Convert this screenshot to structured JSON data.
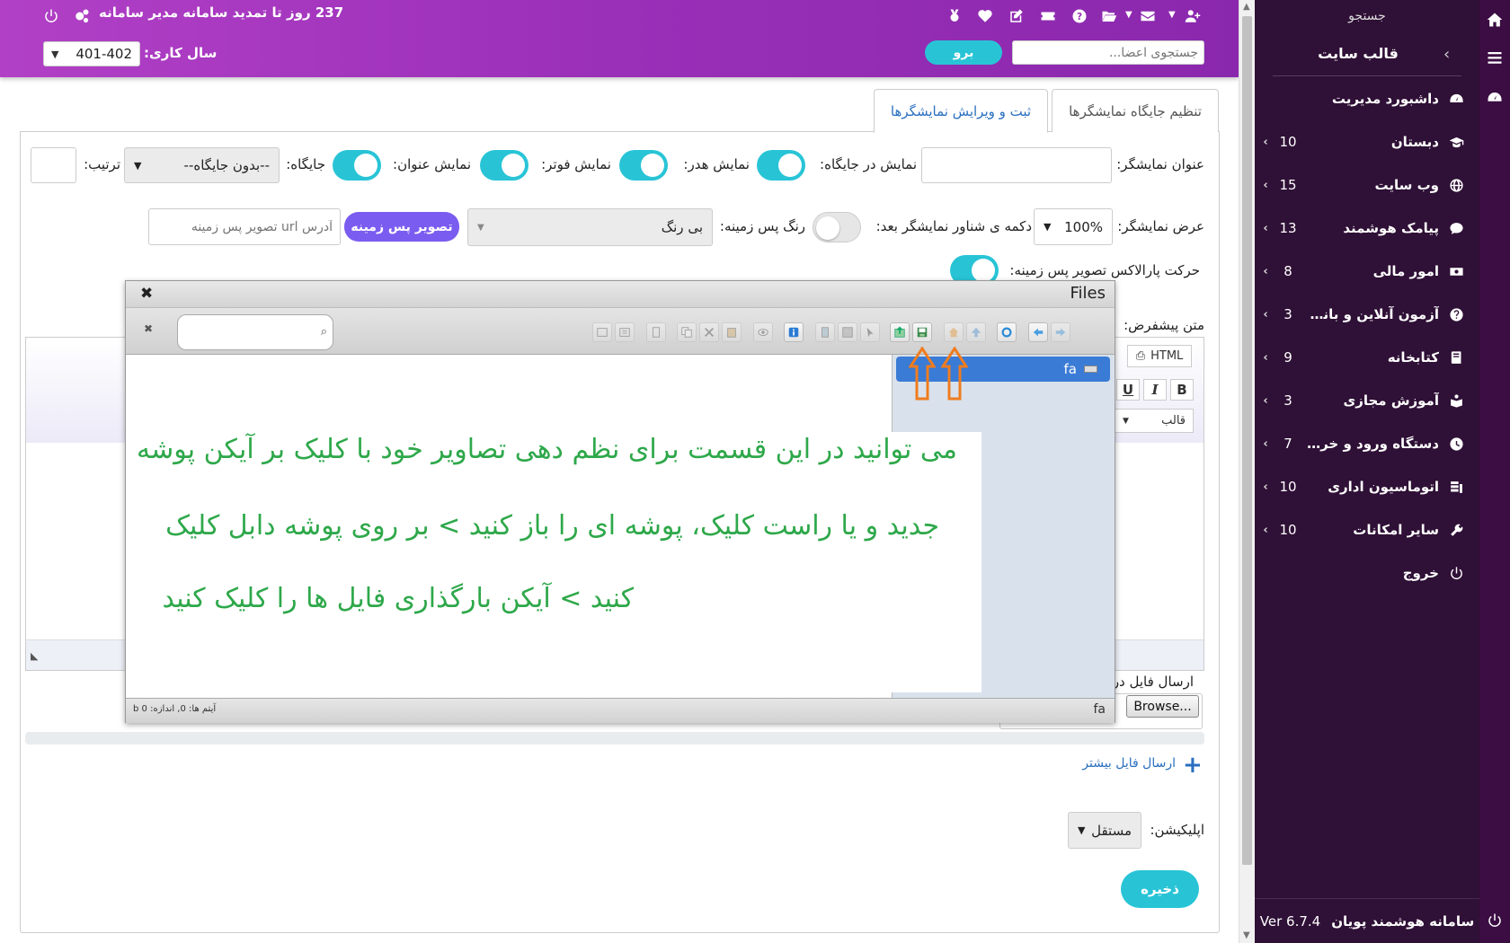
{
  "topbar": {
    "notice": "237 روز تا تمدید سامانه مدیر سامانه",
    "year_label": "سال کاری:",
    "year_value": "401-402",
    "search_placeholder": "جستجوی اعضا...",
    "go_label": "برو"
  },
  "sidebar": {
    "search_label": "جستجو",
    "section_title": "قالب سایت",
    "items": [
      {
        "label": "داشبورد مدیریت",
        "count": "",
        "icon": "dashboard-icon"
      },
      {
        "label": "دبستان",
        "count": "10",
        "icon": "graduation-cap-icon"
      },
      {
        "label": "وب سایت",
        "count": "15",
        "icon": "globe-icon"
      },
      {
        "label": "پیامک هوشمند",
        "count": "13",
        "icon": "sms-icon"
      },
      {
        "label": "امور مالی",
        "count": "8",
        "icon": "money-icon"
      },
      {
        "label": "آزمون آنلاین و بانک س...",
        "count": "3",
        "icon": "question-icon"
      },
      {
        "label": "کتابخانه",
        "count": "9",
        "icon": "book-icon"
      },
      {
        "label": "آموزش مجازی",
        "count": "3",
        "icon": "virtual-class-icon"
      },
      {
        "label": "دستگاه ورود و خروج",
        "count": "7",
        "icon": "clock-icon"
      },
      {
        "label": "اتوماسیون اداری",
        "count": "10",
        "icon": "office-icon"
      },
      {
        "label": "سایر امکانات",
        "count": "10",
        "icon": "wrench-icon"
      },
      {
        "label": "خروج",
        "count": "",
        "icon": "power-icon"
      }
    ],
    "footer_name": "سامانه هوشمند پویان",
    "footer_version": "Ver 6.7.4"
  },
  "tabs": {
    "active": "ثبت و ویرایش نمایشگرها",
    "other": "تنظیم جایگاه نمایشگرها"
  },
  "form": {
    "title_label": "عنوان نمایشگر:",
    "show_in_place": "نمایش در جایگاه:",
    "show_header": "نمایش هدر:",
    "show_footer": "نمایش فوتر:",
    "show_title": "نمایش عنوان:",
    "place_label": "جایگاه:",
    "place_value": "--بدون جایگاه--",
    "order_label": "ترتیب:",
    "width_label": "عرض نمایشگر:",
    "width_value": "100%",
    "float_btn_label": "دکمه ی شناور نمایشگر بعد:",
    "bg_color_label": "رنگ پس زمینه:",
    "bg_color_value": "بی رنگ",
    "bg_image_button": "تصویر پس زمینه",
    "bg_url_placeholder": "آدرس url تصویر پس زمینه",
    "parallax_label": "حرکت پارالاکس تصویر پس زمینه:",
    "default_text_label": "متن پیشفرض:",
    "editor_html": "HTML",
    "editor_template": "قالب",
    "upload_label": "ارسال فایل در",
    "browse_label": "Browse...",
    "more_files": "ارسال فایل بیشتر",
    "app_label": "اپلیکیشن:",
    "app_value": "مستقل",
    "save_label": "ذخیره"
  },
  "dialog": {
    "title": "Files",
    "folder": "fa",
    "status": "آیتم ها: 0, اندازه: 0 b",
    "status_right": "fa",
    "instruction_lines": [
      "می توانید در این قسمت برای نظم دهی تصاویر خود با کلیک بر آیکن پوشه",
      "جدید و یا راست کلیک، پوشه ای را باز کنید > بر روی پوشه دابل کلیک",
      "کنید > آیکن بارگذاری فایل ها را کلیک کنید"
    ]
  },
  "colors": {
    "topbar": "#9b30b9",
    "sidebar": "#2f1036",
    "accent": "#28c4d6",
    "purple_button": "#7b5cf0",
    "instruction_text": "#2ea84a",
    "arrow": "#f07c1e"
  }
}
